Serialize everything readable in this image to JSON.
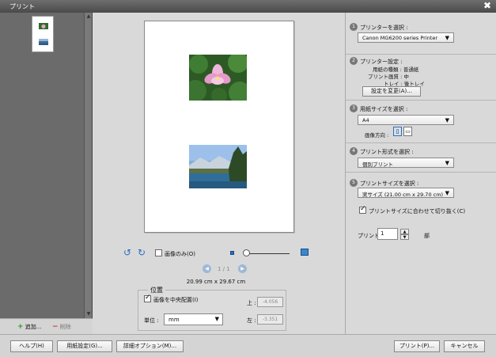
{
  "window": {
    "title": "プリント",
    "close_glyph": "✖"
  },
  "left_panel": {
    "add_label": "追加...",
    "delete_label": "削除"
  },
  "preview": {
    "rotate_left_glyph": "↺",
    "rotate_right_glyph": "↻",
    "image_only_label": "画像のみ(O)",
    "page_indicator": "1 / 1",
    "dimensions": "20.99 cm x 29.67 cm"
  },
  "position": {
    "title": "位置",
    "center_label": "画像を中央配置(I)",
    "unit_label": "単位 :",
    "unit_value": "mm",
    "top_label": "上 :",
    "top_value": "-4.056",
    "left_label": "左 :",
    "left_value": "-3.351"
  },
  "right_panel": {
    "s1": {
      "num": "1",
      "title": "プリンターを選択 :",
      "printer": "Canon MG6200 series Printer"
    },
    "s2": {
      "num": "2",
      "title": "プリンター設定 :",
      "paper_type": "用紙の種類 : 普通紙",
      "quality": "プリント画質 : 中",
      "tray": "トレイ : 後トレイ",
      "change_btn": "設定を変更(A)..."
    },
    "s3": {
      "num": "3",
      "title": "用紙サイズを選択 :",
      "size": "A4",
      "orientation_label": "画像方向 :"
    },
    "s4": {
      "num": "4",
      "title": "プリント形式を選択 :",
      "format": "個別プリント"
    },
    "s5": {
      "num": "5",
      "title": "プリントサイズを選択 :",
      "size": "実サイズ (21.00 cm x 29.70 cm)",
      "crop_label": "プリントサイズに合わせて切り抜く(C)"
    },
    "copies_label": "プリント",
    "copies_value": "1",
    "copies_unit": "部"
  },
  "footer": {
    "help": "ヘルプ(H)",
    "page_setup": "用紙設定(G)...",
    "more_options": "詳細オプション(M)...",
    "print": "プリント(P)...",
    "cancel": "キャンセル"
  }
}
